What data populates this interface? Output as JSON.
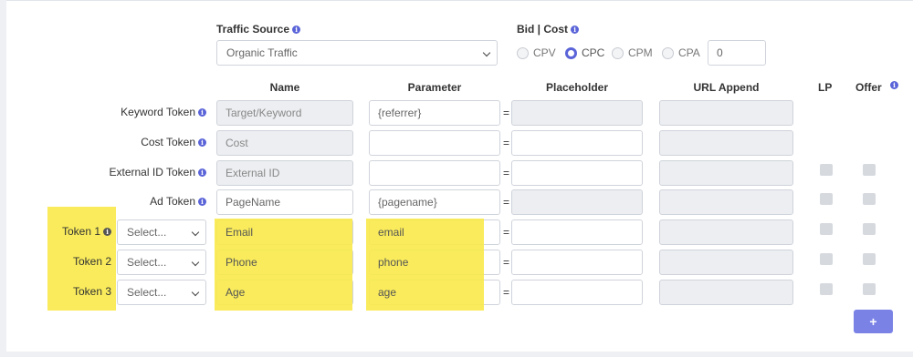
{
  "traffic_source": {
    "label": "Traffic Source",
    "selected": "Organic Traffic"
  },
  "bid_cost": {
    "label": "Bid | Cost",
    "options": [
      "CPV",
      "CPC",
      "CPM",
      "CPA"
    ],
    "selected": "CPC",
    "value": "0"
  },
  "columns": {
    "name": "Name",
    "parameter": "Parameter",
    "placeholder": "Placeholder",
    "url_append": "URL Append",
    "lp": "LP",
    "offer": "Offer"
  },
  "rows": [
    {
      "label": "Keyword Token",
      "name": "Target/Keyword",
      "parameter": "{referrer}",
      "placeholder": "",
      "url_append": ""
    },
    {
      "label": "Cost Token",
      "name": "Cost",
      "parameter": "",
      "placeholder": "",
      "url_append": ""
    },
    {
      "label": "External ID Token",
      "name": "External ID",
      "parameter": "",
      "placeholder": "",
      "url_append": ""
    },
    {
      "label": "Ad Token",
      "name": "PageName",
      "parameter": "{pagename}",
      "placeholder": "",
      "url_append": ""
    }
  ],
  "custom_rows": [
    {
      "label": "Token 1",
      "select": "Select...",
      "name": "Email",
      "parameter": "email"
    },
    {
      "label": "Token 2",
      "select": "Select...",
      "name": "Phone",
      "parameter": "phone"
    },
    {
      "label": "Token 3",
      "select": "Select...",
      "name": "Age",
      "parameter": "age"
    }
  ],
  "equals": "=",
  "add_button": "+",
  "colors": {
    "accent": "#5a64d8",
    "button": "#7a82e6",
    "highlight": "#f9e94d"
  }
}
